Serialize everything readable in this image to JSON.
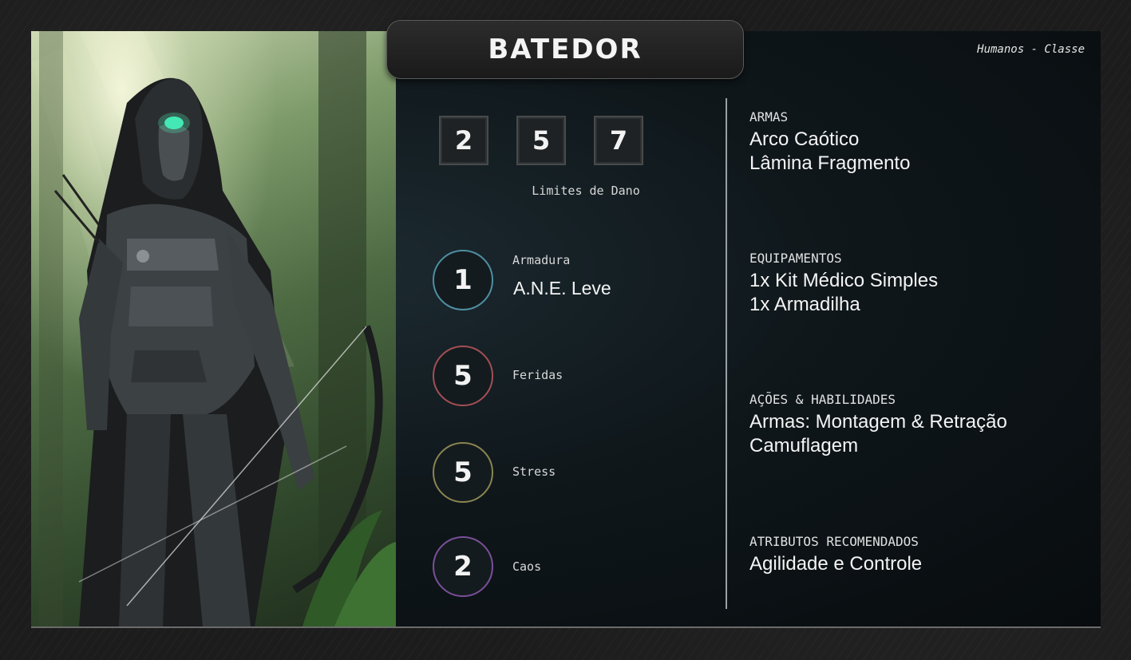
{
  "card": {
    "title": "BATEDOR",
    "subtitle": "Humanos - Classe"
  },
  "limits": {
    "values": [
      "2",
      "5",
      "7"
    ],
    "label": "Limites de Dano"
  },
  "stats": [
    {
      "value": "1",
      "label": "Armadura",
      "detail": "A.N.E. Leve",
      "color": "#4f8fa3"
    },
    {
      "value": "5",
      "label": "Feridas",
      "color": "#a34f55"
    },
    {
      "value": "5",
      "label": "Stress",
      "color": "#8a8550"
    },
    {
      "value": "2",
      "label": "Caos",
      "color": "#7a4f9a"
    }
  ],
  "sections": [
    {
      "heading": "ARMAS",
      "lines": [
        "Arco Caótico",
        "Lâmina Fragmento"
      ]
    },
    {
      "heading": "EQUIPAMENTOS",
      "lines": [
        "1x Kit Médico Simples",
        "1x Armadilha"
      ]
    },
    {
      "heading": "AÇÕES & HABILIDADES",
      "lines": [
        "Armas: Montagem & Retração",
        "Camuflagem"
      ]
    },
    {
      "heading": "ATRIBUTOS RECOMENDADOS",
      "lines": [
        "Agilidade e Controle"
      ]
    }
  ]
}
